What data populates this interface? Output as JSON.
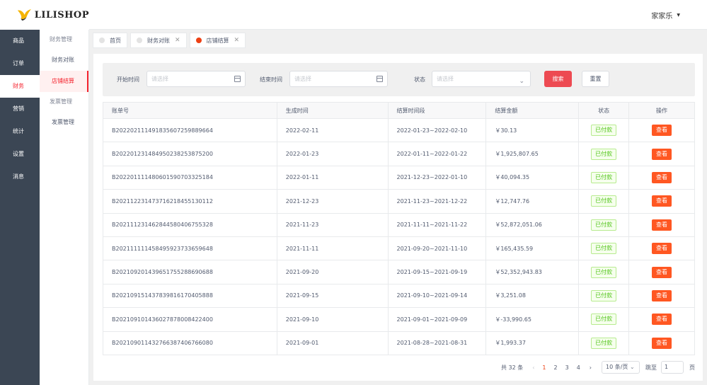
{
  "brand": {
    "name": "LILISHOP",
    "accent": "#ed4014"
  },
  "user": {
    "name": "家家乐"
  },
  "nav_primary": [
    "商品",
    "订单",
    "财务",
    "营销",
    "统计",
    "设置",
    "消息"
  ],
  "nav_secondary": {
    "groups": [
      {
        "title": "财务管理",
        "items": [
          "财务对账",
          "店铺结算"
        ]
      },
      {
        "title": "发票管理",
        "items": [
          "发票管理"
        ]
      }
    ]
  },
  "tabs": [
    "首页",
    "财务对账",
    "店铺结算"
  ],
  "filter": {
    "start_label": "开始时间",
    "start_placeholder": "请选择",
    "end_label": "结束时间",
    "end_placeholder": "请选择",
    "status_label": "状态",
    "status_placeholder": "请选择",
    "search_label": "搜索",
    "reset_label": "重置"
  },
  "table": {
    "headers": [
      "账单号",
      "生成时间",
      "结算时间段",
      "结算金额",
      "状态",
      "操作"
    ],
    "rows": [
      [
        "B202202111491835607259889664",
        "2022-02-11",
        "2022-01-23~2022-02-10",
        "￥30.13",
        "已付款",
        "查看"
      ],
      [
        "B202201231484950238253875200",
        "2022-01-23",
        "2022-01-11~2022-01-22",
        "￥1,925,807.65",
        "已付款",
        "查看"
      ],
      [
        "B202201111480601590703325184",
        "2022-01-11",
        "2021-12-23~2022-01-10",
        "￥40,094.35",
        "已付款",
        "查看"
      ],
      [
        "B202112231473716218455130112",
        "2021-12-23",
        "2021-11-23~2021-12-22",
        "￥12,747.76",
        "已付款",
        "查看"
      ],
      [
        "B202111231462844580406755328",
        "2021-11-23",
        "2021-11-11~2021-11-22",
        "￥52,872,051.06",
        "已付款",
        "查看"
      ],
      [
        "B202111111458495923733659648",
        "2021-11-11",
        "2021-09-20~2021-11-10",
        "￥165,435.59",
        "已付款",
        "查看"
      ],
      [
        "B202109201439651755288690688",
        "2021-09-20",
        "2021-09-15~2021-09-19",
        "￥52,352,943.83",
        "已付款",
        "查看"
      ],
      [
        "B202109151437839816170405888",
        "2021-09-15",
        "2021-09-10~2021-09-14",
        "￥3,251.08",
        "已付款",
        "查看"
      ],
      [
        "B202109101436027878008422400",
        "2021-09-10",
        "2021-09-01~2021-09-09",
        "￥-33,990.65",
        "已付款",
        "查看"
      ],
      [
        "B202109011432766387406766080",
        "2021-09-01",
        "2021-08-28~2021-08-31",
        "￥1,993.37",
        "已付款",
        "查看"
      ]
    ]
  },
  "pagination": {
    "total": "共 32 条",
    "pages": [
      "1",
      "2",
      "3",
      "4"
    ],
    "page_size": "10 条/页",
    "jump_label": "跳至",
    "jump_value": "1",
    "page_suffix": "页"
  }
}
